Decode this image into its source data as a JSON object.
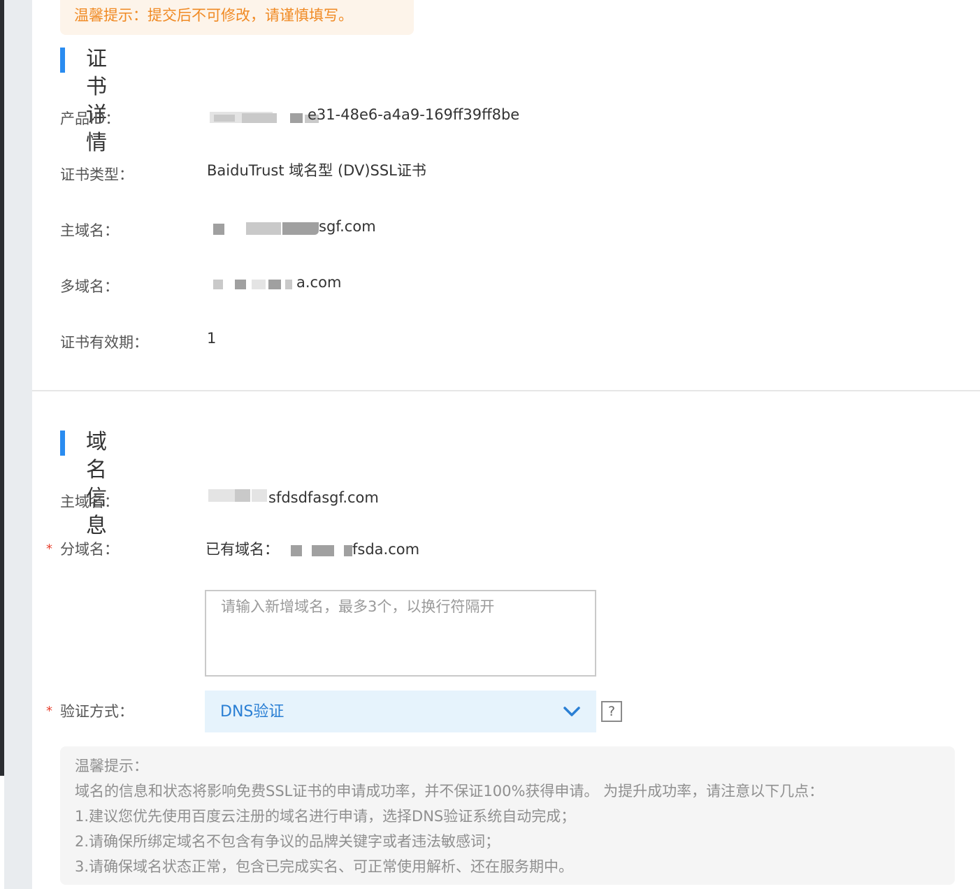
{
  "top_tip": "温馨提示：提交后不可修改，请谨慎填写。",
  "certificate_section": {
    "title": "证书详情",
    "fields": {
      "product_id": {
        "label": "产品ID：",
        "value": "e31-48e6-a4a9-169ff39ff8be"
      },
      "cert_type": {
        "label": "证书类型：",
        "value": "BaiduTrust 域名型 (DV)SSL证书"
      },
      "main_domain": {
        "label": "主域名：",
        "value": "sgf.com"
      },
      "multi_domain": {
        "label": "多域名：",
        "value": "a.com"
      },
      "validity": {
        "label": "证书有效期：",
        "value": "1"
      }
    }
  },
  "domain_section": {
    "title": "域名信息",
    "main_domain": {
      "label": "主域名：",
      "value": "sfdsdfasgf.com"
    },
    "sub_domain": {
      "required_mark": "*",
      "label": "分域名：",
      "existing_prefix": "已有域名：",
      "existing_value": "fsda.com",
      "input_placeholder": "请输入新增域名，最多3个，以换行符隔开"
    },
    "verify_method": {
      "required_mark": "*",
      "label": "验证方式：",
      "selected": "DNS验证",
      "help_icon": "?"
    }
  },
  "notice": {
    "lines": [
      "温馨提示：",
      "域名的信息和状态将影响免费SSL证书的申请成功率，并不保证100%获得申请。 为提升成功率，请注意以下几点：",
      "1.建议您优先使用百度云注册的域名进行申请，选择DNS验证系统自动完成；",
      "2.请确保所绑定域名不包含有争议的品牌关键字或者违法敏感词；",
      "3.请确保域名状态正常，包含已完成实名、可正常使用解析、还在服务期中。"
    ]
  },
  "colors": {
    "accent": "#2a8cf0",
    "warning_text": "#f08a24",
    "warning_bg": "#fdf4ea",
    "required": "#e8412f",
    "select_bg": "#e6f3fc",
    "select_text": "#2a7fd4"
  },
  "icons": {
    "dropdown": "chevron-down-icon",
    "help": "help-icon"
  }
}
